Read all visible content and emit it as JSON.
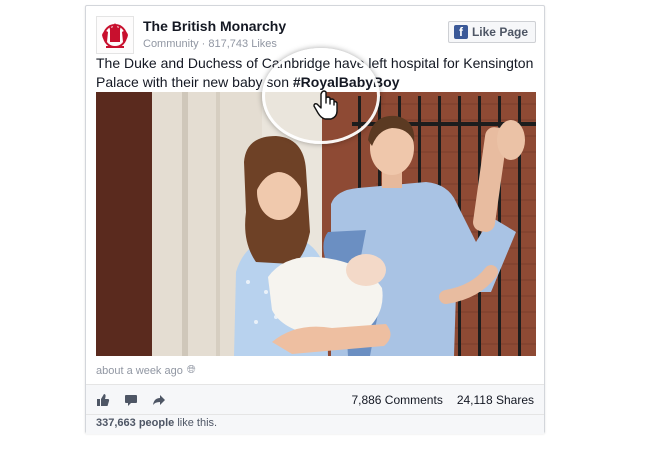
{
  "page": {
    "name": "The British Monarchy",
    "meta": "Community · 817,743 Likes",
    "like_button": "Like Page"
  },
  "post": {
    "text_line1": "The Duke and Duchess of Cambridge have left hospital for Kensington",
    "text_line2": "Palace with their new baby son",
    "hashtag": "#RoyalBabyBoy",
    "timestamp": "about a week ago"
  },
  "stats": {
    "comments": "7,886 Comments",
    "shares": "24,118 Shares"
  },
  "likes": {
    "count": "337,663 people",
    "suffix": " like this."
  },
  "colors": {
    "facebook_blue": "#3b5998",
    "meta_grey": "#9197a3",
    "crest_red": "#c8102e"
  },
  "icons": [
    "crest-icon",
    "facebook-icon",
    "globe-icon",
    "like-thumb-icon",
    "comment-icon",
    "share-icon",
    "hand-cursor-icon"
  ]
}
